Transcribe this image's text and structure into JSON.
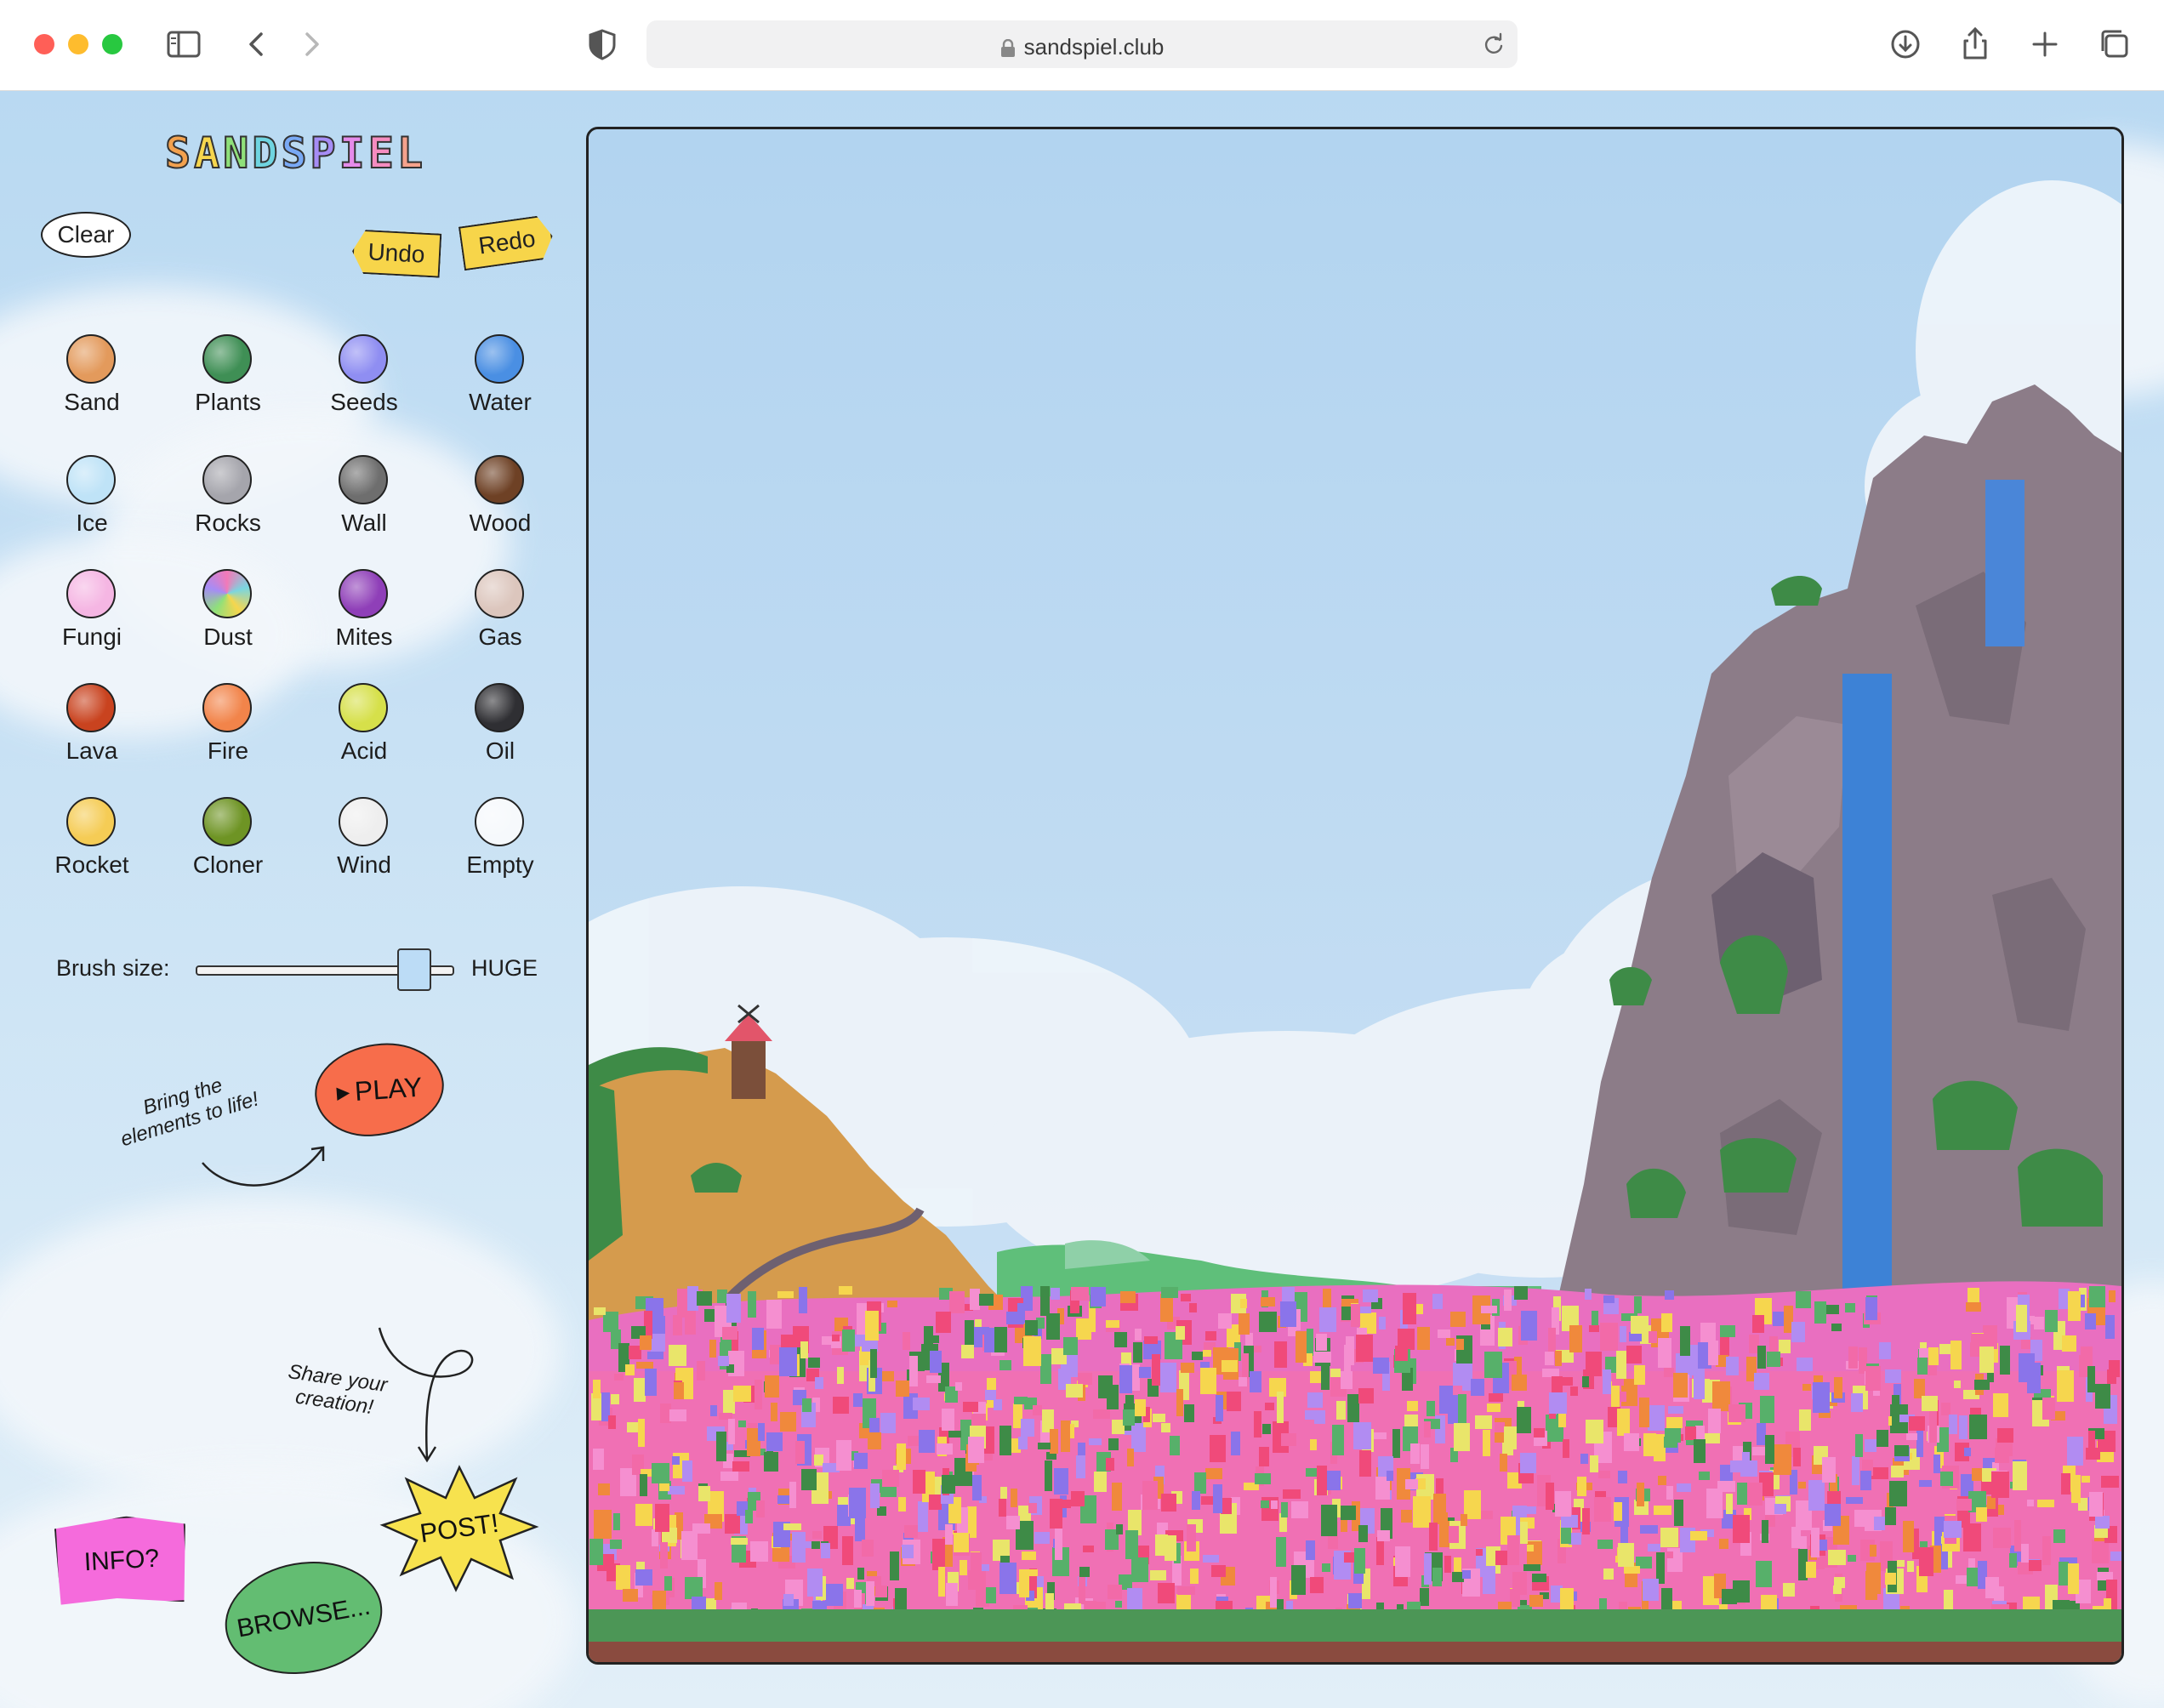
{
  "browser": {
    "url": "sandspiel.club"
  },
  "app": {
    "logo_letters": [
      {
        "char": "S",
        "color": "#f2a14e"
      },
      {
        "char": "A",
        "color": "#f6d64e"
      },
      {
        "char": "N",
        "color": "#8fe07a"
      },
      {
        "char": "D",
        "color": "#6fd4e0"
      },
      {
        "char": "S",
        "color": "#79a9f5"
      },
      {
        "char": "P",
        "color": "#a68cf5"
      },
      {
        "char": "I",
        "color": "#e58bea"
      },
      {
        "char": "E",
        "color": "#f58cc0"
      },
      {
        "char": "L",
        "color": "#f5a28c"
      }
    ],
    "toolbar": {
      "clear_label": "Clear",
      "undo_label": "Undo",
      "redo_label": "Redo"
    },
    "elements": [
      {
        "label": "Sand",
        "color": "#e39a5c",
        "icon": "sand-swatch-icon"
      },
      {
        "label": "Plants",
        "color": "#3f8f55",
        "icon": "plants-swatch-icon"
      },
      {
        "label": "Seeds",
        "color": "#8f8ef2",
        "icon": "seeds-swatch-icon"
      },
      {
        "label": "Water",
        "color": "#4a8fe3",
        "icon": "water-swatch-icon"
      },
      {
        "label": "Ice",
        "color": "#bfe3f7",
        "icon": "ice-swatch-icon"
      },
      {
        "label": "Rocks",
        "color": "#a5a5ac",
        "icon": "rocks-swatch-icon"
      },
      {
        "label": "Wall",
        "color": "#6e6e6e",
        "icon": "wall-swatch-icon"
      },
      {
        "label": "Wood",
        "color": "#6e4125",
        "icon": "wood-swatch-icon"
      },
      {
        "label": "Fungi",
        "color": "#f5b6e3",
        "icon": "fungi-swatch-icon"
      },
      {
        "label": "Dust",
        "color": "#e9b96a",
        "icon": "dust-swatch-icon"
      },
      {
        "label": "Mites",
        "color": "#8f3fb8",
        "icon": "mites-swatch-icon"
      },
      {
        "label": "Gas",
        "color": "#dcc6bd",
        "icon": "gas-swatch-icon"
      },
      {
        "label": "Lava",
        "color": "#c9431f",
        "icon": "lava-swatch-icon"
      },
      {
        "label": "Fire",
        "color": "#f2844a",
        "icon": "fire-swatch-icon"
      },
      {
        "label": "Acid",
        "color": "#d6e04a",
        "icon": "acid-swatch-icon"
      },
      {
        "label": "Oil",
        "color": "#2f2f33",
        "icon": "oil-swatch-icon"
      },
      {
        "label": "Rocket",
        "color": "#f5cc55",
        "icon": "rocket-swatch-icon"
      },
      {
        "label": "Cloner",
        "color": "#6e9424",
        "icon": "cloner-swatch-icon"
      },
      {
        "label": "Wind",
        "color": "#eeeeee",
        "icon": "wind-swatch-icon"
      },
      {
        "label": "Empty",
        "color": "#f6f9fc",
        "icon": "empty-swatch-icon"
      }
    ],
    "brush": {
      "label": "Brush size:",
      "value_label": "HUGE",
      "level": 0.85
    },
    "play": {
      "label": "PLAY",
      "hint": "Bring the elements to life!"
    },
    "share_hint": "Share your creation!",
    "buttons": {
      "info": "INFO?",
      "browse": "BROWSE...",
      "post": "POST!"
    }
  }
}
